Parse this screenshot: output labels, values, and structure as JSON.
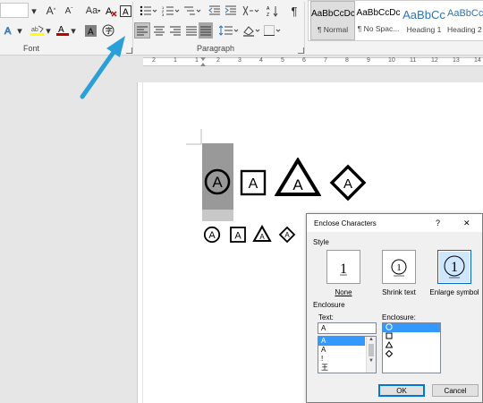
{
  "ribbon": {
    "font_size_value": "",
    "font_size_up": "A",
    "font_size_down": "A",
    "change_case": "Aa",
    "subscript": "x",
    "superscript": "x",
    "font_color_letter": "A",
    "highlight_letters": "ab",
    "show_formatting_symbol": "¶",
    "font_group_label": "Font",
    "paragraph_group_label": "Paragraph",
    "accent_color": "#2e75b6",
    "font_color": "#c00000",
    "highlight_color": "#ffff00"
  },
  "styles": [
    {
      "preview": "AaBbCcDc",
      "name": "¶ Normal"
    },
    {
      "preview": "AaBbCcDc",
      "name": "¶ No Spac..."
    },
    {
      "preview": "AaBbCc",
      "name": "Heading 1"
    },
    {
      "preview": "AaBbCc",
      "name": "Heading 2"
    }
  ],
  "ruler": {
    "marks": [
      "2",
      "1",
      "1",
      "2",
      "3",
      "4",
      "5",
      "6",
      "7",
      "8",
      "9",
      "10",
      "11",
      "12",
      "13",
      "14"
    ]
  },
  "document": {
    "large_glyphs": [
      {
        "letter": "A",
        "enclosure": "circle"
      },
      {
        "letter": "A",
        "enclosure": "square"
      },
      {
        "letter": "A",
        "enclosure": "triangle"
      },
      {
        "letter": "A",
        "enclosure": "diamond"
      }
    ],
    "small_glyphs": [
      {
        "letter": "A",
        "enclosure": "circle"
      },
      {
        "letter": "A",
        "enclosure": "square"
      },
      {
        "letter": "A",
        "enclosure": "triangle"
      },
      {
        "letter": "A",
        "enclosure": "diamond"
      }
    ]
  },
  "dialog": {
    "title": "Enclose Characters",
    "help_glyph": "?",
    "close_glyph": "✕",
    "style_label": "Style",
    "style_options": [
      {
        "name": "None",
        "sample": "1",
        "selected": false
      },
      {
        "name": "Shrink text",
        "sample": "1",
        "selected": false
      },
      {
        "name": "Enlarge symbol",
        "sample": "1",
        "selected": true
      }
    ],
    "enclosure_section_label": "Enclosure",
    "text_label": "Text:",
    "text_value": "A",
    "text_items": [
      "A",
      "A",
      "!",
      "王"
    ],
    "enclosure_label": "Enclosure:",
    "enclosure_items": [
      "circle",
      "square",
      "triangle",
      "diamond"
    ],
    "ok_label": "OK",
    "cancel_label": "Cancel"
  }
}
